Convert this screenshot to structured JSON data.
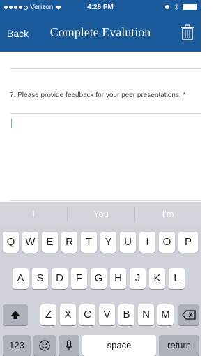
{
  "status": {
    "carrier": "Verizon",
    "time": "4:26 PM"
  },
  "nav": {
    "back": "Back",
    "title": "Complete Evalution"
  },
  "question": {
    "text": "7. Please provide feedback for your peer presentations. *"
  },
  "predictions": [
    "I",
    "You",
    "I'm"
  ],
  "keyboard": {
    "row1": [
      "Q",
      "W",
      "E",
      "R",
      "T",
      "Y",
      "U",
      "I",
      "O",
      "P"
    ],
    "row2": [
      "A",
      "S",
      "D",
      "F",
      "G",
      "H",
      "J",
      "K",
      "L"
    ],
    "row3": [
      "Z",
      "X",
      "C",
      "V",
      "B",
      "N",
      "M"
    ],
    "num": "123",
    "space": "space",
    "return": "return"
  },
  "colors": {
    "header": "#1a5a9a"
  }
}
